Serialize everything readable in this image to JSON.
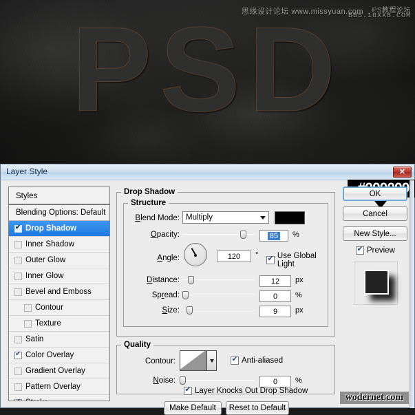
{
  "photo": {
    "display_text": "PSD",
    "watermark_cn_1": "思缘设计论坛 www.missyuan.com",
    "watermark_cn_2": "PS教程论坛",
    "watermark_url_2": "BBS.16XX8.COM",
    "watermark_bottom": "wodernet.com"
  },
  "dialog": {
    "title": "Layer Style",
    "close_label": "✕"
  },
  "styles_panel": {
    "header": "Styles",
    "blending_options": "Blending Options: Default",
    "items": [
      {
        "label": "Drop Shadow",
        "checked": true,
        "selected": true,
        "indent": false,
        "enabled": true
      },
      {
        "label": "Inner Shadow",
        "checked": false,
        "selected": false,
        "indent": false,
        "enabled": false
      },
      {
        "label": "Outer Glow",
        "checked": false,
        "selected": false,
        "indent": false,
        "enabled": false
      },
      {
        "label": "Inner Glow",
        "checked": false,
        "selected": false,
        "indent": false,
        "enabled": false
      },
      {
        "label": "Bevel and Emboss",
        "checked": false,
        "selected": false,
        "indent": false,
        "enabled": false
      },
      {
        "label": "Contour",
        "checked": false,
        "selected": false,
        "indent": true,
        "enabled": false
      },
      {
        "label": "Texture",
        "checked": false,
        "selected": false,
        "indent": true,
        "enabled": false
      },
      {
        "label": "Satin",
        "checked": false,
        "selected": false,
        "indent": false,
        "enabled": false
      },
      {
        "label": "Color Overlay",
        "checked": true,
        "selected": false,
        "indent": false,
        "enabled": true
      },
      {
        "label": "Gradient Overlay",
        "checked": false,
        "selected": false,
        "indent": false,
        "enabled": false
      },
      {
        "label": "Pattern Overlay",
        "checked": false,
        "selected": false,
        "indent": false,
        "enabled": false
      },
      {
        "label": "Stroke",
        "checked": true,
        "selected": false,
        "indent": false,
        "enabled": true
      }
    ]
  },
  "drop_shadow": {
    "group_title": "Drop Shadow",
    "structure_title": "Structure",
    "blend_mode_label": "Blend Mode:",
    "blend_mode_value": "Multiply",
    "color_swatch_hex": "#000000",
    "callout_text": "#000000",
    "opacity_label": "Opacity:",
    "opacity_value": "85",
    "opacity_unit": "%",
    "angle_label": "Angle:",
    "angle_value": "120",
    "angle_unit": "°",
    "use_global_light_label": "Use Global Light",
    "use_global_light_checked": true,
    "distance_label": "Distance:",
    "distance_value": "12",
    "distance_unit": "px",
    "spread_label": "Spread:",
    "spread_value": "0",
    "spread_unit": "%",
    "size_label": "Size:",
    "size_value": "9",
    "size_unit": "px"
  },
  "quality": {
    "group_title": "Quality",
    "contour_label": "Contour:",
    "anti_aliased_label": "Anti-aliased",
    "anti_aliased_checked": true,
    "noise_label": "Noise:",
    "noise_value": "0",
    "noise_unit": "%"
  },
  "footer": {
    "knockout_label": "Layer Knocks Out Drop Shadow",
    "knockout_checked": true,
    "make_default": "Make Default",
    "reset_to_default": "Reset to Default"
  },
  "right_panel": {
    "ok": "OK",
    "cancel": "Cancel",
    "new_style": "New Style...",
    "preview_label": "Preview",
    "preview_checked": true
  }
}
